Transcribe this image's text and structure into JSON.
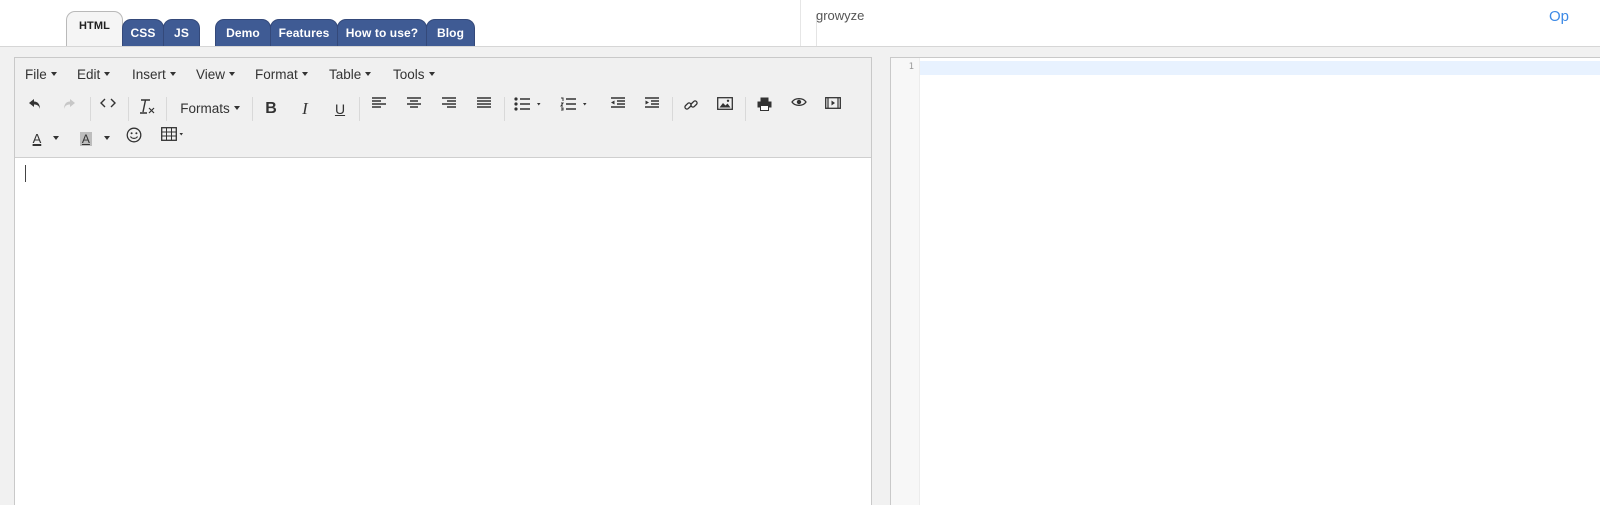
{
  "tabs": {
    "html": "HTML",
    "css": "CSS",
    "js": "JS",
    "demo": "Demo",
    "features": "Features",
    "how_to_use": "How to use?",
    "blog": "Blog"
  },
  "ad": {
    "brand": "growyze",
    "cta": "Op"
  },
  "menu": {
    "file": "File",
    "edit": "Edit",
    "insert": "Insert",
    "view": "View",
    "format": "Format",
    "table": "Table",
    "tools": "Tools"
  },
  "toolbar": {
    "formats_label": "Formats",
    "bold": "B",
    "italic": "I",
    "underline": "U",
    "text_color_letter": "A",
    "bg_color_letter": "A",
    "icons": [
      "undo-icon",
      "redo-icon",
      "source-code-icon",
      "clear-formatting-icon",
      "align-left-icon",
      "align-center-icon",
      "align-right-icon",
      "justify-icon",
      "bullet-list-icon",
      "numbered-list-icon",
      "outdent-icon",
      "indent-icon",
      "link-icon",
      "image-icon",
      "print-icon",
      "preview-icon",
      "media-icon",
      "emoticon-icon",
      "table-icon"
    ]
  },
  "code_editor": {
    "line_number": "1"
  },
  "colors": {
    "tab_blue": "#3f5b94",
    "active_line": "#e8f2ff",
    "cta_blue": "#3d8ae6"
  }
}
